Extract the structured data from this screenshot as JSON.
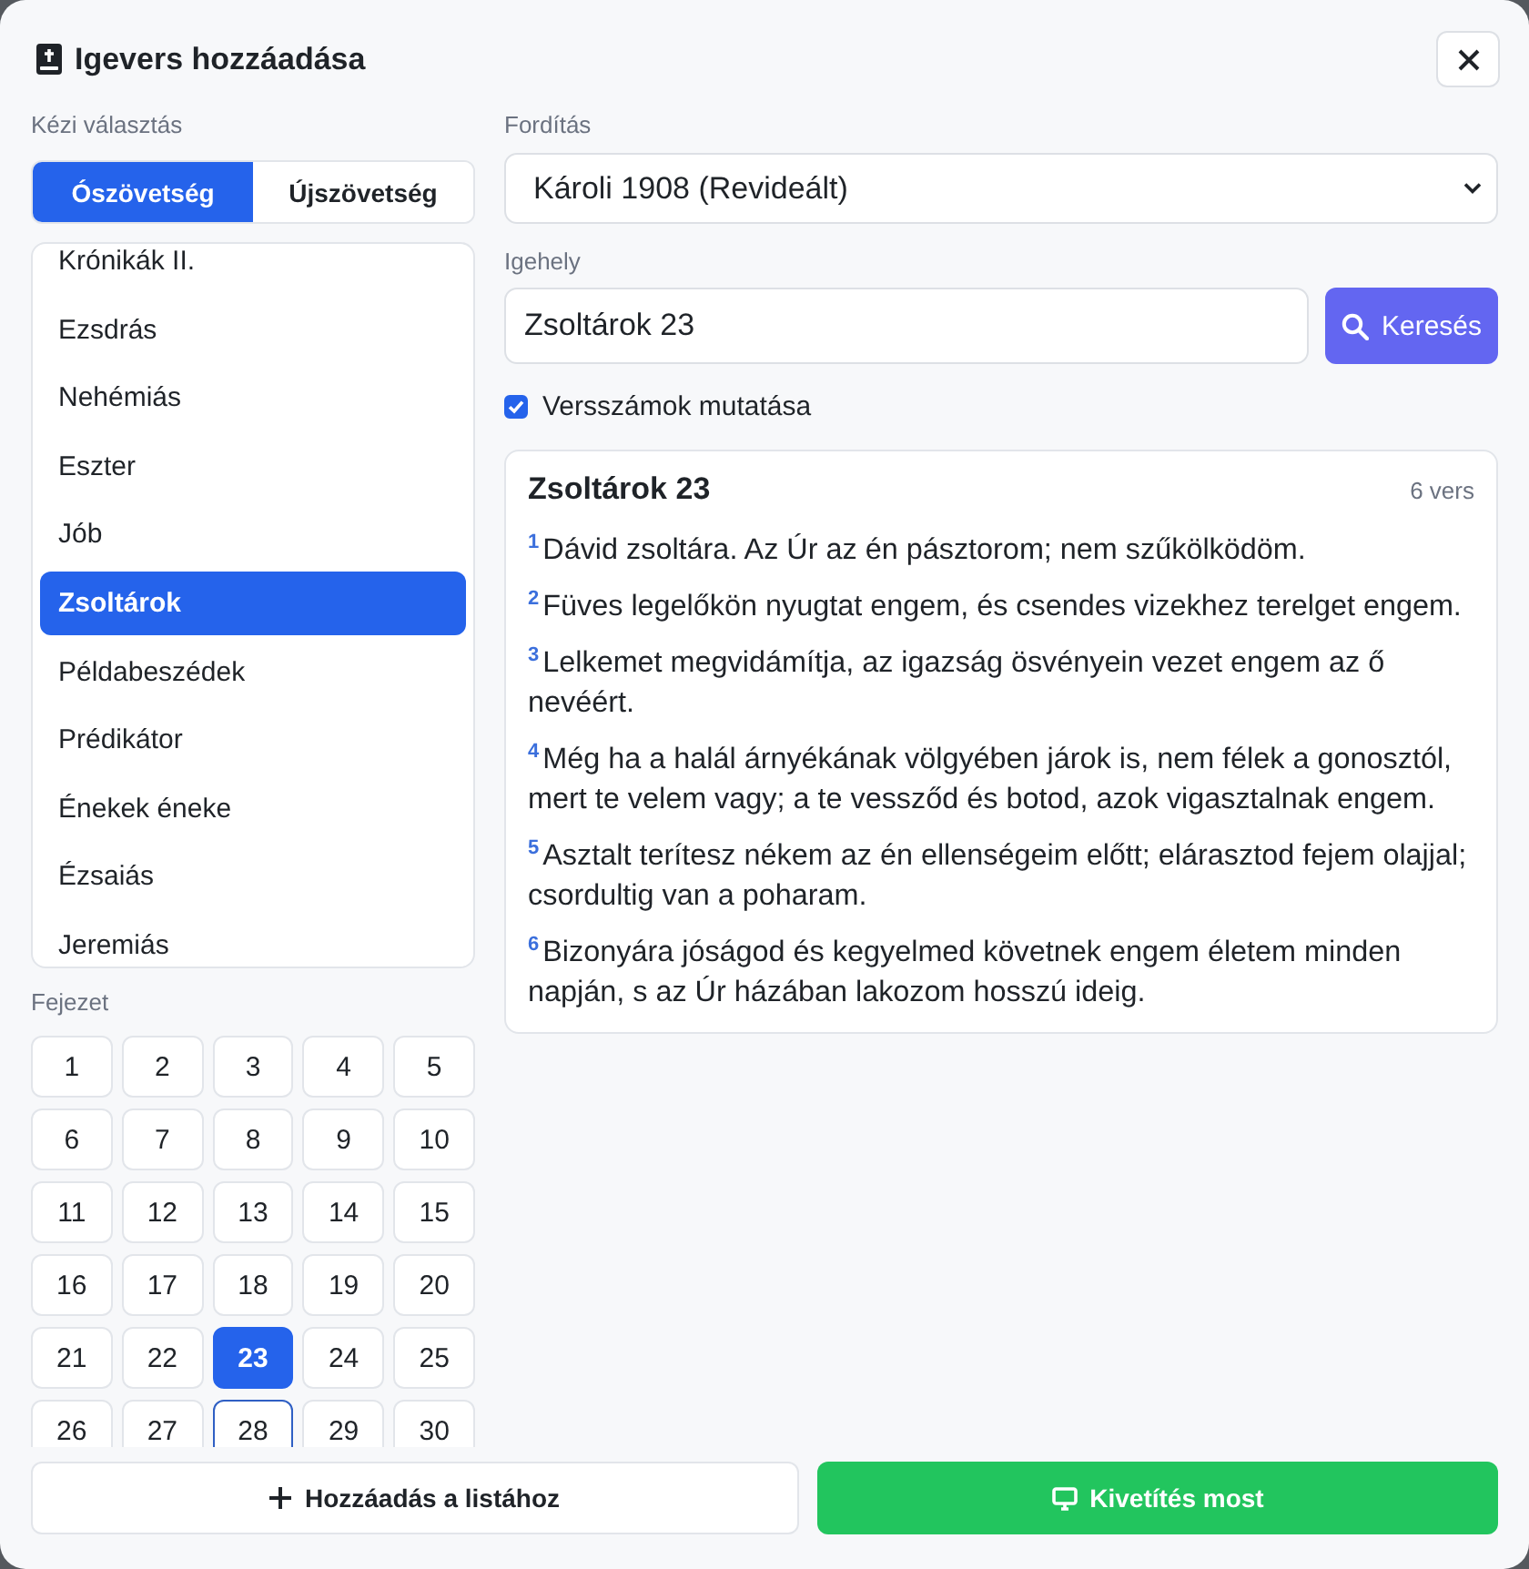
{
  "dialog": {
    "title": "Igevers hozzáadása"
  },
  "manual": {
    "label": "Kézi választás",
    "testaments": [
      {
        "label": "Ószövetség",
        "selected": true
      },
      {
        "label": "Újszövetség",
        "selected": false
      }
    ],
    "books": [
      {
        "name": "Krónikák II.",
        "selected": false
      },
      {
        "name": "Ezsdrás",
        "selected": false
      },
      {
        "name": "Nehémiás",
        "selected": false
      },
      {
        "name": "Eszter",
        "selected": false
      },
      {
        "name": "Jób",
        "selected": false
      },
      {
        "name": "Zsoltárok",
        "selected": true
      },
      {
        "name": "Példabeszédek",
        "selected": false
      },
      {
        "name": "Prédikátor",
        "selected": false
      },
      {
        "name": "Énekek éneke",
        "selected": false
      },
      {
        "name": "Ézsaiás",
        "selected": false
      },
      {
        "name": "Jeremiás",
        "selected": false
      }
    ],
    "chapter_label": "Fejezet",
    "chapters": [
      {
        "number": "1",
        "selected": false,
        "focused": false
      },
      {
        "number": "2",
        "selected": false,
        "focused": false
      },
      {
        "number": "3",
        "selected": false,
        "focused": false
      },
      {
        "number": "4",
        "selected": false,
        "focused": false
      },
      {
        "number": "5",
        "selected": false,
        "focused": false
      },
      {
        "number": "6",
        "selected": false,
        "focused": false
      },
      {
        "number": "7",
        "selected": false,
        "focused": false
      },
      {
        "number": "8",
        "selected": false,
        "focused": false
      },
      {
        "number": "9",
        "selected": false,
        "focused": false
      },
      {
        "number": "10",
        "selected": false,
        "focused": false
      },
      {
        "number": "11",
        "selected": false,
        "focused": false
      },
      {
        "number": "12",
        "selected": false,
        "focused": false
      },
      {
        "number": "13",
        "selected": false,
        "focused": false
      },
      {
        "number": "14",
        "selected": false,
        "focused": false
      },
      {
        "number": "15",
        "selected": false,
        "focused": false
      },
      {
        "number": "16",
        "selected": false,
        "focused": false
      },
      {
        "number": "17",
        "selected": false,
        "focused": false
      },
      {
        "number": "18",
        "selected": false,
        "focused": false
      },
      {
        "number": "19",
        "selected": false,
        "focused": false
      },
      {
        "number": "20",
        "selected": false,
        "focused": false
      },
      {
        "number": "21",
        "selected": false,
        "focused": false
      },
      {
        "number": "22",
        "selected": false,
        "focused": false
      },
      {
        "number": "23",
        "selected": true,
        "focused": false
      },
      {
        "number": "24",
        "selected": false,
        "focused": false
      },
      {
        "number": "25",
        "selected": false,
        "focused": false
      },
      {
        "number": "26",
        "selected": false,
        "focused": false
      },
      {
        "number": "27",
        "selected": false,
        "focused": false
      },
      {
        "number": "28",
        "selected": false,
        "focused": true
      },
      {
        "number": "29",
        "selected": false,
        "focused": false
      },
      {
        "number": "30",
        "selected": false,
        "focused": false
      }
    ]
  },
  "translation": {
    "label": "Fordítás",
    "value": "Károli 1908 (Revideált)"
  },
  "reference": {
    "label": "Igehely",
    "value": "Zsoltárok 23",
    "button": "Keresés"
  },
  "show_verse_numbers": {
    "label": "Versszámok mutatása",
    "checked": true
  },
  "passage": {
    "title": "Zsoltárok 23",
    "count": "6 vers",
    "verses": [
      {
        "number": "1",
        "text": "Dávid zsoltára. Az Úr az én pásztorom; nem szűkölködöm."
      },
      {
        "number": "2",
        "text": "Füves legelőkön nyugtat engem, és csendes vizekhez terelget engem."
      },
      {
        "number": "3",
        "text": "Lelkemet megvidámítja, az igazság ösvényein vezet engem az ő nevéért."
      },
      {
        "number": "4",
        "text": "Még ha a halál árnyékának völgyében járok is, nem félek a gonosztól, mert te velem vagy; a te vessződ és botod, azok vigasztalnak engem."
      },
      {
        "number": "5",
        "text": "Asztalt terítesz nékem az én ellenségeim előtt; elárasztod fejem olajjal; csordultig van a poharam."
      },
      {
        "number": "6",
        "text": "Bizonyára jóságod és kegyelmed követnek engem életem minden napján, s az Úr házában lakozom hosszú ideig."
      }
    ]
  },
  "footer": {
    "buttons": [
      {
        "kind": "add",
        "label": "Hozzáadás a listához"
      },
      {
        "kind": "project",
        "label": "Kivetítés most"
      }
    ]
  }
}
